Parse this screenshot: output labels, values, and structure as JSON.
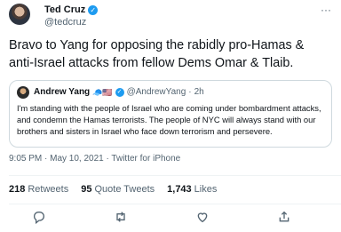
{
  "author": {
    "name": "Ted Cruz",
    "handle": "@tedcruz",
    "verified_icon": "verified-badge-icon"
  },
  "tweet": {
    "text": "Bravo to Yang for opposing the rabidly pro-Hamas &\nanti-Israel attacks from fellow Dems Omar & Tlaib."
  },
  "quoted": {
    "name": "Andrew Yang",
    "emoji": "🧢🇺🇸",
    "handle": "@AndrewYang",
    "separator": "·",
    "time": "2h",
    "text": "I'm standing with the people of Israel who are coming under bombardment attacks, and condemn the Hamas terrorists. The people of NYC will always stand with our brothers and sisters in Israel who face down terrorism and persevere."
  },
  "meta": {
    "text": "9:05 PM · May 10, 2021 · Twitter for iPhone"
  },
  "stats": {
    "retweets_count": "218",
    "retweets_label": "Retweets",
    "quotes_count": "95",
    "quotes_label": "Quote Tweets",
    "likes_count": "1,743",
    "likes_label": "Likes"
  },
  "colors": {
    "verified": "#1d9bf0",
    "secondary_text": "#536471",
    "primary_text": "#0f1419",
    "border": "#cfd9de"
  },
  "icons": [
    "reply-icon",
    "retweet-icon",
    "like-icon",
    "share-icon",
    "more-options-icon"
  ]
}
